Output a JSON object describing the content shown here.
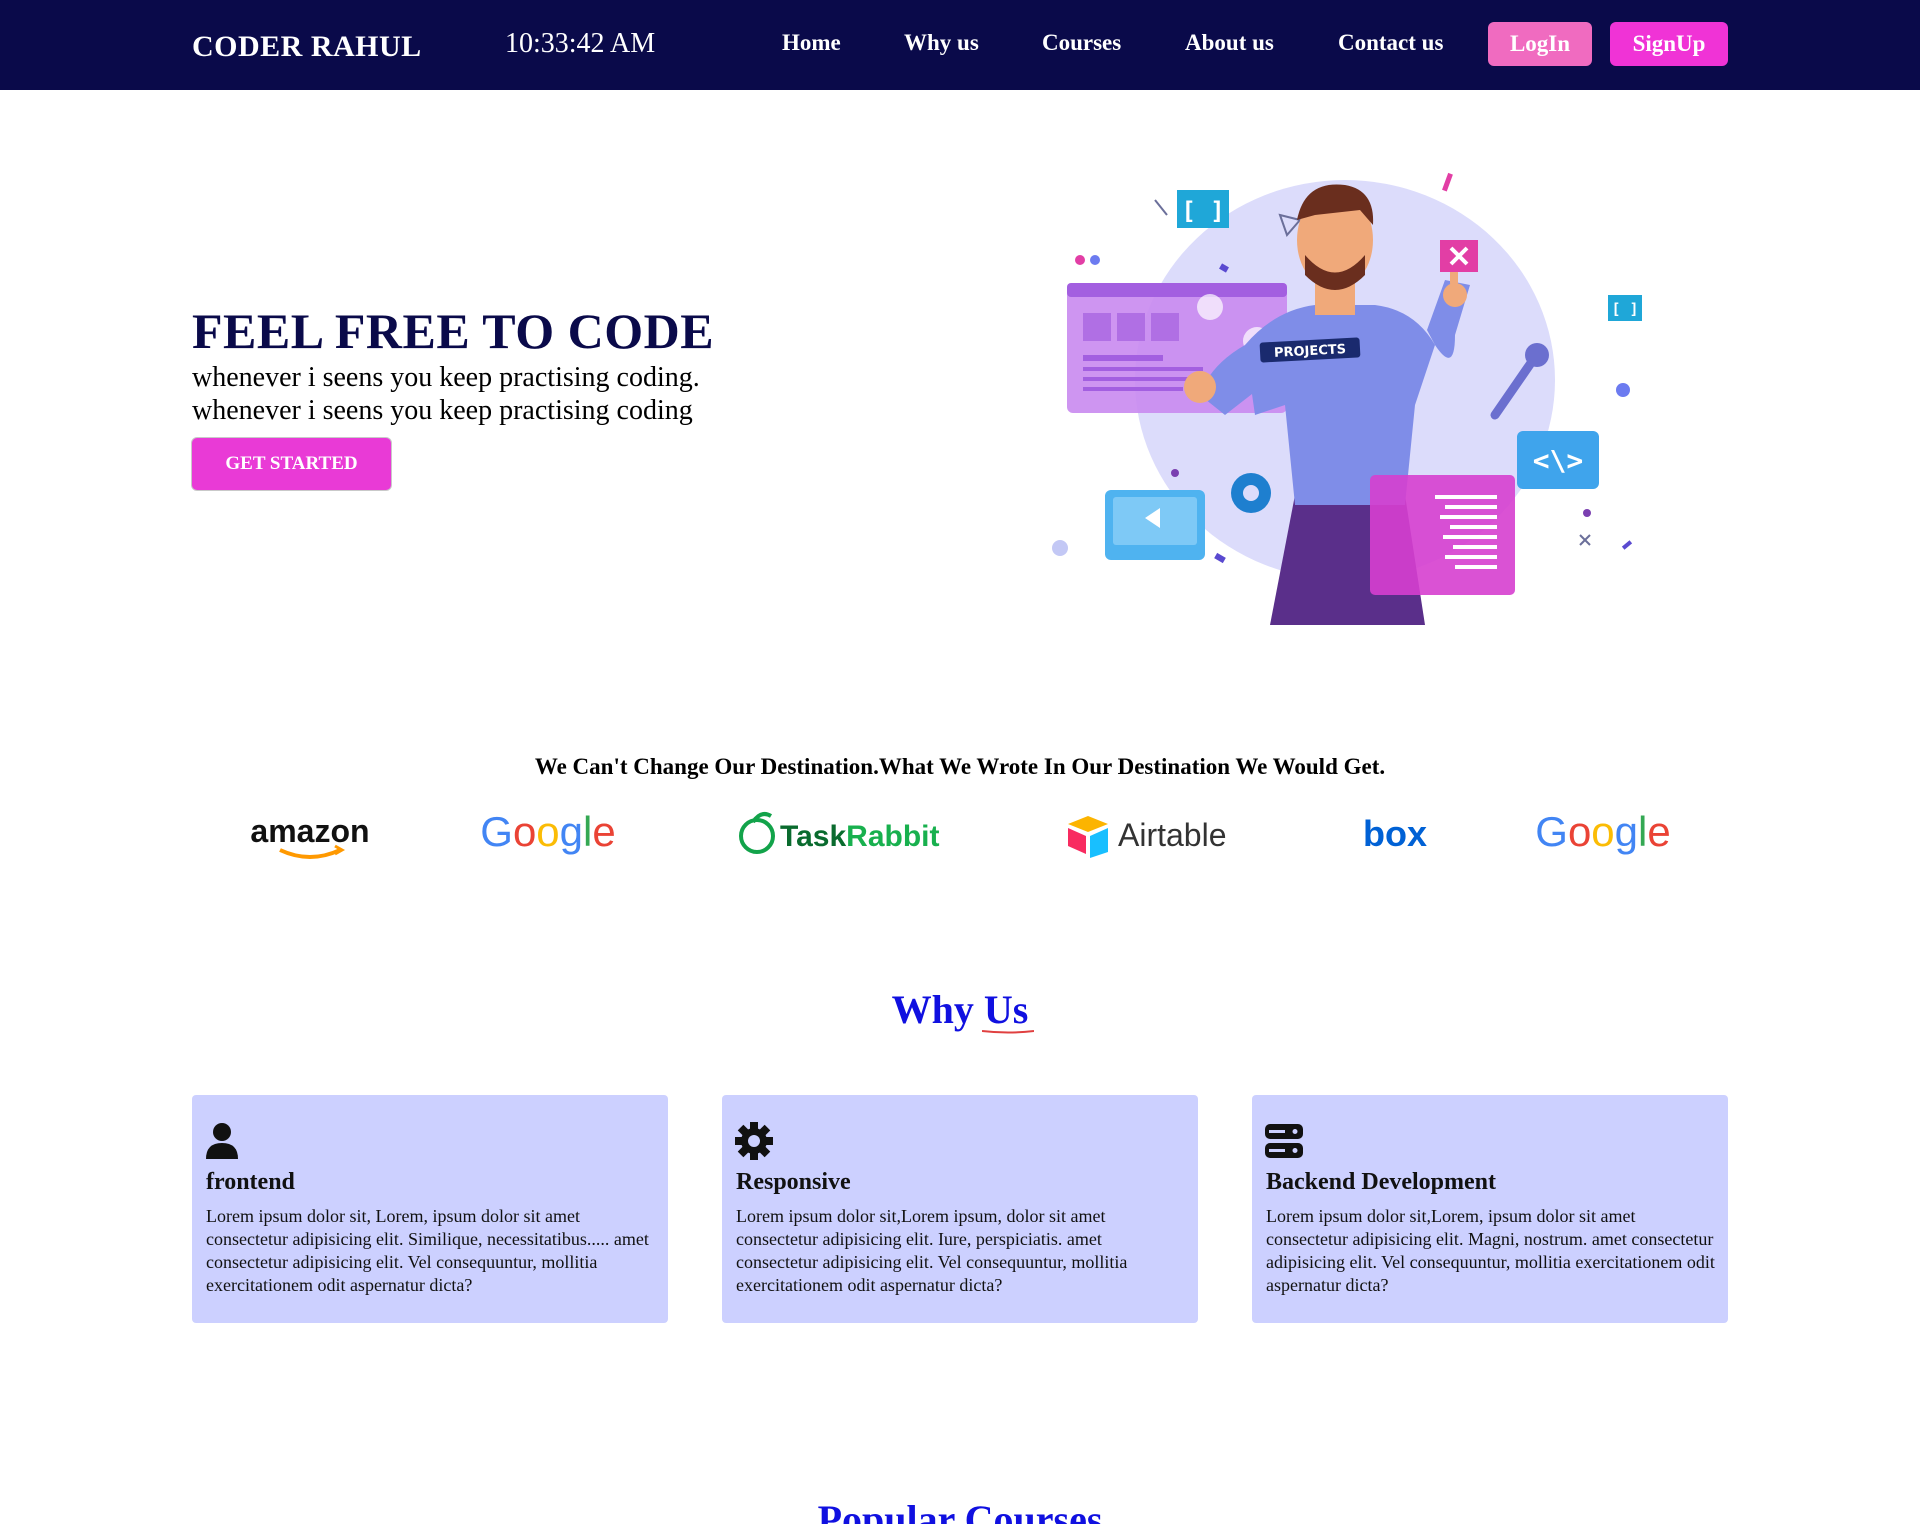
{
  "navbar": {
    "brand": "CODER RAHUL",
    "clock": "10:33:42 AM",
    "links": [
      "Home",
      "Why us",
      "Courses",
      "About us",
      "Contact us"
    ],
    "login_label": "LogIn",
    "signup_label": "SignUp",
    "background": "#0a0a4a"
  },
  "hero": {
    "title": "FEEL FREE TO CODE",
    "line1": "whenever i seens you keep practising coding.",
    "line2": "whenever i seens you keep practising coding",
    "cta_label": "GET STARTED",
    "cta_color": "#e93ad6",
    "illustration_shirt_text": "PROJECTS"
  },
  "partners": {
    "tagline": "We Can't Change Our Destination.What We Wrote In Our Destination We Would Get.",
    "logos": [
      "amazon",
      "Google",
      "TaskRabbit",
      "Airtable",
      "box",
      "Google"
    ]
  },
  "why_us": {
    "heading": "Why Us",
    "card_color": "#ccd0ff",
    "cards": [
      {
        "icon": "user-icon",
        "title": "frontend",
        "text": "Lorem ipsum dolor sit, Lorem, ipsum dolor sit amet consectetur adipisicing elit. Similique, necessitatibus..... amet consectetur adipisicing elit. Vel consequuntur, mollitia exercitationem odit aspernatur dicta?"
      },
      {
        "icon": "gear-icon",
        "title": "Responsive",
        "text": "Lorem ipsum dolor sit,Lorem ipsum, dolor sit amet consectetur adipisicing elit. Iure, perspiciatis. amet consectetur adipisicing elit. Vel consequuntur, mollitia exercitationem odit aspernatur dicta?"
      },
      {
        "icon": "server-icon",
        "title": "Backend Development",
        "text": "Lorem ipsum dolor sit,Lorem, ipsum dolor sit amet consectetur adipisicing elit. Magni, nostrum. amet consectetur adipisicing elit. Vel consequuntur, mollitia exercitationem odit aspernatur dicta?"
      }
    ]
  },
  "popular": {
    "heading": "Popular Courses"
  }
}
